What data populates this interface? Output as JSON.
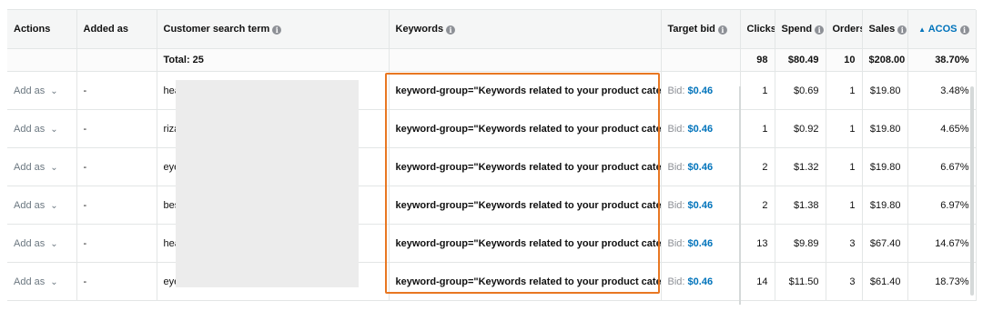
{
  "columns": {
    "actions": "Actions",
    "added_as": "Added as",
    "search_term": "Customer search term",
    "keywords": "Keywords",
    "target_bid": "Target bid",
    "clicks": "Clicks",
    "spend": "Spend",
    "orders": "Orders",
    "sales": "Sales",
    "acos": "ACOS",
    "sort_arrow": "▲"
  },
  "totals": {
    "label": "Total: 25",
    "clicks": "98",
    "spend": "$80.49",
    "orders": "10",
    "sales": "$208.00",
    "acos": "38.70%"
  },
  "rows": [
    {
      "action": "Add as",
      "added_as": "-",
      "term": "hea",
      "keyword": "keyword-group=\"Keywords related to your product category\"",
      "bid_label": "Bid:",
      "bid": "$0.46",
      "clicks": "1",
      "spend": "$0.69",
      "orders": "1",
      "sales": "$19.80",
      "acos": "3.48%"
    },
    {
      "action": "Add as",
      "added_as": "-",
      "term": "riza",
      "keyword": "keyword-group=\"Keywords related to your product category\"",
      "bid_label": "Bid:",
      "bid": "$0.46",
      "clicks": "1",
      "spend": "$0.92",
      "orders": "1",
      "sales": "$19.80",
      "acos": "4.65%"
    },
    {
      "action": "Add as",
      "added_as": "-",
      "term": "eye",
      "keyword": "keyword-group=\"Keywords related to your product category\"",
      "bid_label": "Bid:",
      "bid": "$0.46",
      "clicks": "2",
      "spend": "$1.32",
      "orders": "1",
      "sales": "$19.80",
      "acos": "6.67%"
    },
    {
      "action": "Add as",
      "added_as": "-",
      "term": "bes",
      "keyword": "keyword-group=\"Keywords related to your product category\"",
      "bid_label": "Bid:",
      "bid": "$0.46",
      "clicks": "2",
      "spend": "$1.38",
      "orders": "1",
      "sales": "$19.80",
      "acos": "6.97%"
    },
    {
      "action": "Add as",
      "added_as": "-",
      "term": "hea",
      "keyword": "keyword-group=\"Keywords related to your product category\"",
      "bid_label": "Bid:",
      "bid": "$0.46",
      "clicks": "13",
      "spend": "$9.89",
      "orders": "3",
      "sales": "$67.40",
      "acos": "14.67%"
    },
    {
      "action": "Add as",
      "added_as": "-",
      "term": "eye",
      "keyword": "keyword-group=\"Keywords related to your product category\"",
      "bid_label": "Bid:",
      "bid": "$0.46",
      "clicks": "14",
      "spend": "$11.50",
      "orders": "3",
      "sales": "$61.40",
      "acos": "18.73%"
    }
  ],
  "icons": {
    "info": "i",
    "chevron": "⌄"
  },
  "colors": {
    "highlight": "#e87722",
    "link": "#0073bb"
  }
}
